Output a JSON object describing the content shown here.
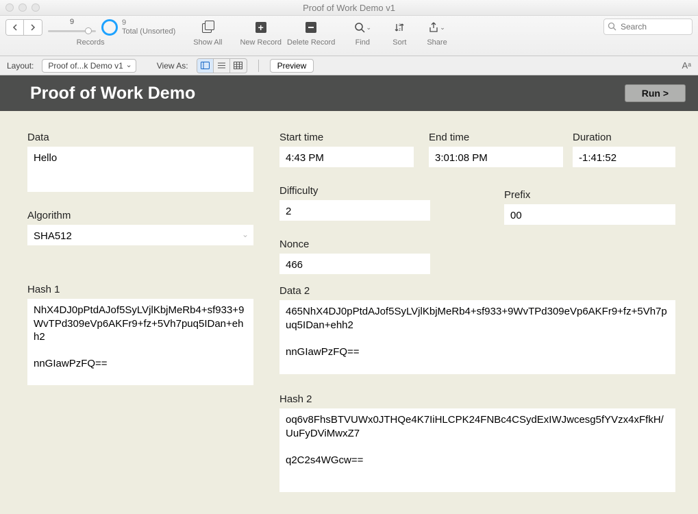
{
  "window": {
    "title": "Proof of Work Demo v1"
  },
  "toolbar": {
    "record_index": "9",
    "total_count": "9",
    "total_label": "Total (Unsorted)",
    "records_label": "Records",
    "show_all": "Show All",
    "new_record": "New Record",
    "delete_record": "Delete Record",
    "find": "Find",
    "sort": "Sort",
    "share": "Share",
    "search_placeholder": "Search"
  },
  "layoutbar": {
    "layout_label": "Layout:",
    "layout_value": "Proof of...k Demo v1",
    "view_as": "View As:",
    "preview": "Preview",
    "aa": "Aᵃ"
  },
  "header": {
    "title": "Proof of Work Demo",
    "run": "Run >"
  },
  "form": {
    "data_label": "Data",
    "data_value": "Hello",
    "algorithm_label": "Algorithm",
    "algorithm_value": "SHA512",
    "start_label": "Start time",
    "start_value": "4:43 PM",
    "end_label": "End time",
    "end_value": "3:01:08 PM",
    "duration_label": "Duration",
    "duration_value": "-1:41:52",
    "difficulty_label": "Difficulty",
    "difficulty_value": "2",
    "prefix_label": "Prefix",
    "prefix_value": "00",
    "nonce_label": "Nonce",
    "nonce_value": "466",
    "hash1_label": "Hash 1",
    "hash1_value": "NhX4DJ0pPtdAJof5SyLVjlKbjMeRb4+sf933+9WvTPd309eVp6AKFr9+fz+5Vh7puq5IDan+ehh2\n\nnnGIawPzFQ==",
    "data2_label": "Data 2",
    "data2_value": "465NhX4DJ0pPtdAJof5SyLVjlKbjMeRb4+sf933+9WvTPd309eVp6AKFr9+fz+5Vh7puq5IDan+ehh2\n\nnnGIawPzFQ==",
    "hash2_label": "Hash 2",
    "hash2_value": "oq6v8FhsBTVUWx0JTHQe4K7IiHLCPK24FNBc4CSydExIWJwcesg5fYVzx4xFfkH/UuFyDViMwxZ7\n\nq2C2s4WGcw=="
  }
}
